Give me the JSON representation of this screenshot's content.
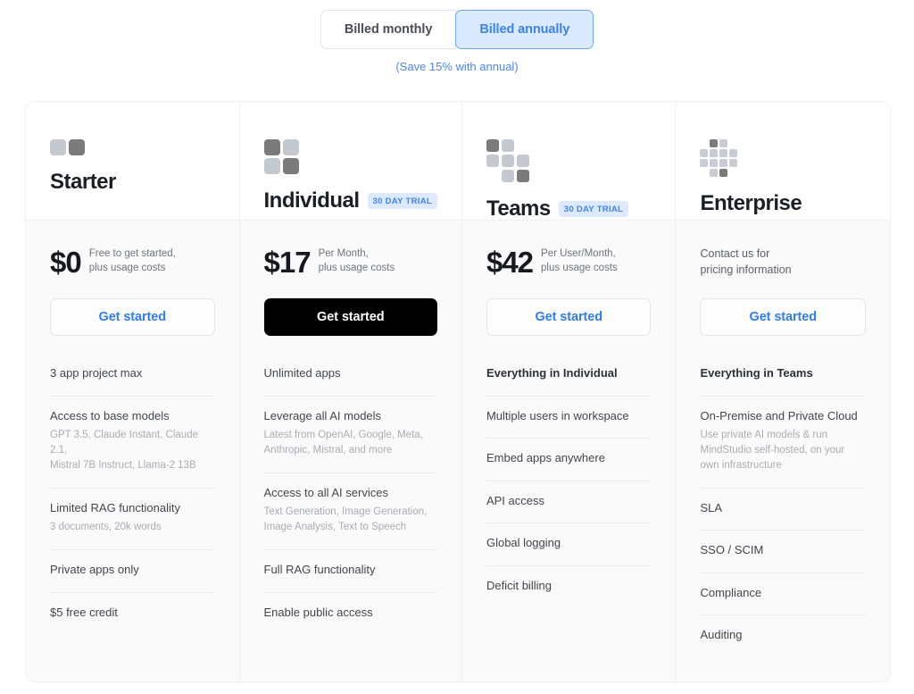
{
  "billing_toggle": {
    "monthly_label": "Billed monthly",
    "annual_label": "Billed annually",
    "save_note": "(Save 15% with annual)",
    "selected": "Billed annually",
    "accent_color": "#3b82f6",
    "active_bg": "#dbeafe"
  },
  "plans": [
    {
      "name": "Starter",
      "icon": "two-squares-icon",
      "icon_cells": [
        "light",
        "dark"
      ],
      "badge": null,
      "price_amount": "$0",
      "price_sub": "Free to get started,\nplus usage costs",
      "price_contact": null,
      "cta_label": "Get started",
      "cta_style": "outline",
      "features": [
        {
          "title": "3 app project max",
          "desc": null,
          "bold": false
        },
        {
          "title": "Access to base models",
          "desc": "GPT 3.5, Claude Instant, Claude 2.1,\nMistral 7B Instruct, Llama-2 13B",
          "bold": false
        },
        {
          "title": "Limited RAG functionality",
          "desc": "3 documents, 20k words",
          "bold": false
        },
        {
          "title": "Private apps only",
          "desc": null,
          "bold": false
        },
        {
          "title": "$5 free credit",
          "desc": null,
          "bold": false
        }
      ]
    },
    {
      "name": "Individual",
      "icon": "four-squares-grid-icon",
      "icon_cells": [
        "dark",
        "light",
        "light",
        "dark"
      ],
      "badge": "30 DAY TRIAL",
      "price_amount": "$17",
      "price_sub": "Per Month,\nplus usage costs",
      "price_contact": null,
      "cta_label": "Get started",
      "cta_style": "primary",
      "features": [
        {
          "title": "Unlimited apps",
          "desc": null,
          "bold": false
        },
        {
          "title": "Leverage all AI models",
          "desc": "Latest from OpenAI, Google, Meta,\nAnthropic, Mistral, and more",
          "bold": false
        },
        {
          "title": "Access to all AI services",
          "desc": "Text Generation, Image Generation,\nImage Analysis, Text to Speech",
          "bold": false
        },
        {
          "title": "Full RAG functionality",
          "desc": null,
          "bold": false
        },
        {
          "title": "Enable public access",
          "desc": null,
          "bold": false
        }
      ]
    },
    {
      "name": "Teams",
      "icon": "staggered-squares-icon",
      "icon_cells": [
        "dark",
        "light",
        "empty",
        "light",
        "light",
        "light",
        "empty",
        "light",
        "dark"
      ],
      "badge": "30 DAY TRIAL",
      "price_amount": "$42",
      "price_sub": "Per User/Month,\nplus usage costs",
      "price_contact": null,
      "cta_label": "Get started",
      "cta_style": "outline",
      "features": [
        {
          "title": "Everything in Individual",
          "desc": null,
          "bold": true
        },
        {
          "title": "Multiple users in workspace",
          "desc": null,
          "bold": false
        },
        {
          "title": "Embed apps anywhere",
          "desc": null,
          "bold": false
        },
        {
          "title": "API access",
          "desc": null,
          "bold": false
        },
        {
          "title": "Global logging",
          "desc": null,
          "bold": false
        },
        {
          "title": "Deficit billing",
          "desc": null,
          "bold": false
        }
      ]
    },
    {
      "name": "Enterprise",
      "icon": "grid-cluster-icon",
      "icon_cells": [
        "empty",
        "dark",
        "light",
        "empty",
        "light",
        "light",
        "light",
        "light",
        "light",
        "light",
        "light",
        "light",
        "empty",
        "light",
        "dark",
        "empty"
      ],
      "badge": null,
      "price_amount": null,
      "price_sub": null,
      "price_contact": "Contact us for\npricing information",
      "cta_label": "Get started",
      "cta_style": "outline",
      "features": [
        {
          "title": "Everything in Teams",
          "desc": null,
          "bold": true
        },
        {
          "title": "On-Premise and Private Cloud",
          "desc": "Use private AI models & run\nMindStudio self-hosted, on your\nown infrastructure",
          "bold": false
        },
        {
          "title": "SLA",
          "desc": null,
          "bold": false
        },
        {
          "title": "SSO / SCIM",
          "desc": null,
          "bold": false
        },
        {
          "title": "Compliance",
          "desc": null,
          "bold": false
        },
        {
          "title": "Auditing",
          "desc": null,
          "bold": false
        }
      ]
    }
  ]
}
